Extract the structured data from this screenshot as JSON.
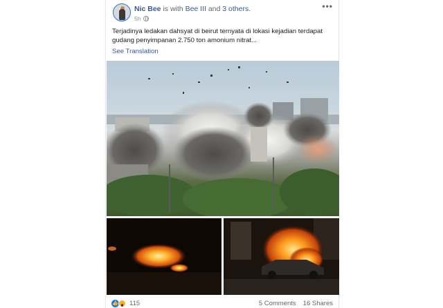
{
  "post": {
    "author": "Nic Bee",
    "with_text": "is with",
    "tagged_friend": "Bee III",
    "and_text": "and",
    "others": "3 others.",
    "time": "5h",
    "body": "Terjadinya ledakan dahsyat di beirut ternyata di lokasi kejadian terdapat gudang penyimpanan 2.750 ton amonium nitrat...",
    "see_translation": "See Translation"
  },
  "footer": {
    "reaction_count": "115",
    "comments": "5 Comments",
    "shares": "16 Shares"
  },
  "icons": {
    "privacy": "globe-icon",
    "reactions": [
      "like-icon",
      "wow-icon"
    ],
    "menu": "more-icon"
  },
  "colors": {
    "link": "#385898",
    "accent": "#1877f2"
  }
}
